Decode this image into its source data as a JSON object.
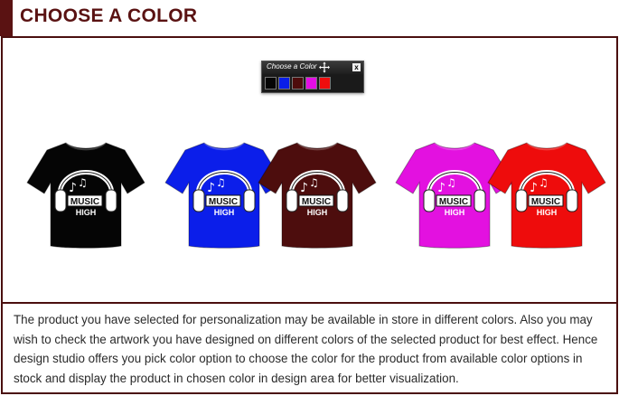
{
  "header": {
    "title": "CHOOSE A COLOR"
  },
  "picker": {
    "title": "Choose a Color",
    "close_label": "x",
    "swatches": [
      {
        "name": "black",
        "color": "#050505"
      },
      {
        "name": "blue",
        "color": "#0a1ee8"
      },
      {
        "name": "maroon",
        "color": "#4e0c0c"
      },
      {
        "name": "magenta",
        "color": "#e40ee4"
      },
      {
        "name": "red",
        "color": "#ef0d0d"
      }
    ]
  },
  "shirts": [
    {
      "name": "black",
      "color": "#050505"
    },
    {
      "name": "blue",
      "color": "#0b1eea"
    },
    {
      "name": "maroon",
      "color": "#4d0d0d"
    },
    {
      "name": "magenta",
      "color": "#e311e0"
    },
    {
      "name": "red",
      "color": "#ee0c0c"
    }
  ],
  "artwork": {
    "line1": "MUSIC",
    "line2": "HIGH"
  },
  "description": "The product you have selected for personalization may be available in store in different colors. Also you may wish to check the artwork you have designed on different colors of the selected product for best effect. Hence design studio offers you pick color option to choose the color for the product from available color options in stock and display the product in chosen color in design area for better visualization."
}
